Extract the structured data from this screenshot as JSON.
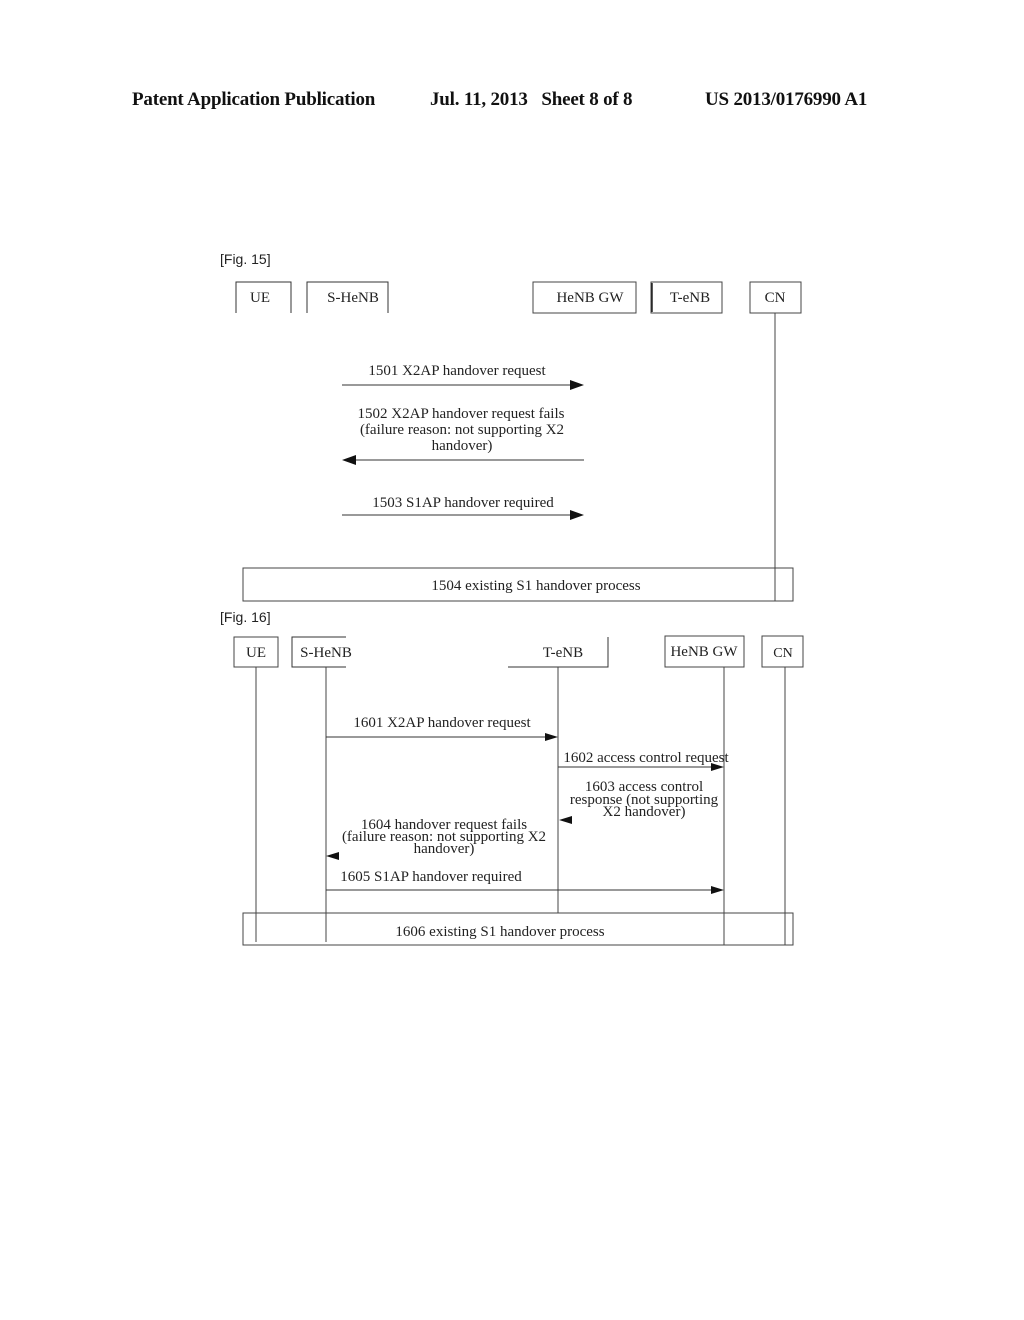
{
  "header": {
    "publication": "Patent Application Publication",
    "date_sheet": "Jul. 11, 2013   Sheet 8 of 8",
    "number": "US 2013/0176990 A1"
  },
  "fig15": {
    "label": "[Fig. 15]",
    "entities": [
      "UE",
      "S-HeNB",
      "HeNB GW",
      "T-eNB",
      "CN"
    ],
    "messages": [
      {
        "id": "1501",
        "lines": [
          "1501 X2AP handover request"
        ],
        "direction": "right"
      },
      {
        "id": "1502",
        "lines": [
          "1502 X2AP handover request fails",
          "(failure reason: not supporting X2",
          "handover)"
        ],
        "direction": "left"
      },
      {
        "id": "1503",
        "lines": [
          "1503 S1AP handover required"
        ],
        "direction": "right"
      }
    ],
    "process": "1504 existing S1 handover process"
  },
  "fig16": {
    "label": "[Fig. 16]",
    "entities": [
      "UE",
      "S-HeNB",
      "T-eNB",
      "HeNB GW",
      "CN"
    ],
    "messages": [
      {
        "id": "1601",
        "lines": [
          "1601 X2AP handover request"
        ],
        "direction": "right"
      },
      {
        "id": "1602",
        "lines": [
          "1602 access control request"
        ],
        "direction": "right"
      },
      {
        "id": "1603",
        "lines": [
          "1603 access control",
          "response (not supporting",
          "X2 handover)"
        ],
        "direction": "left"
      },
      {
        "id": "1604",
        "lines": [
          "1604 handover request fails",
          "(failure reason: not supporting X2",
          "handover)"
        ],
        "direction": "left"
      },
      {
        "id": "1605",
        "lines": [
          "1605 S1AP handover required"
        ],
        "direction": "right"
      }
    ],
    "process": "1606 existing S1 handover process"
  }
}
